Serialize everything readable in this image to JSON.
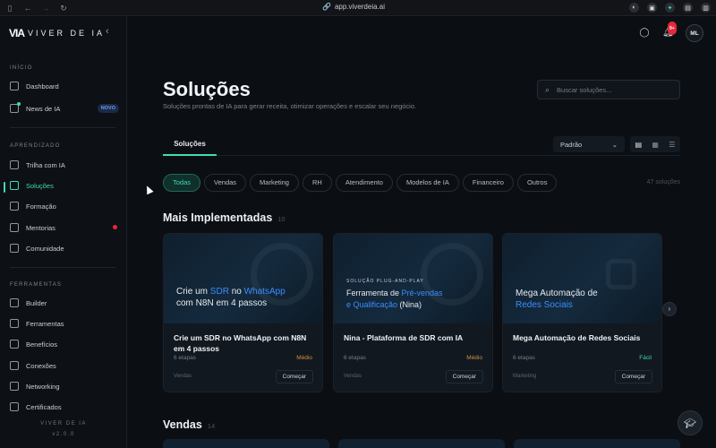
{
  "browser": {
    "url": "app.viverdeia.ai"
  },
  "brand": {
    "name": "VIVER DE IA"
  },
  "sidebar": {
    "sections": [
      {
        "label": "INÍCIO"
      },
      {
        "label": "APRENDIZADO"
      },
      {
        "label": "FERRAMENTAS"
      }
    ],
    "items": [
      {
        "label": "Dashboard",
        "icon": "home-icon"
      },
      {
        "label": "News de IA",
        "icon": "rss-icon",
        "badge": "NOVO"
      },
      {
        "label": "Trilha com IA",
        "icon": "path-icon"
      },
      {
        "label": "Soluções",
        "icon": "book-icon",
        "active": true
      },
      {
        "label": "Formação",
        "icon": "graduation-icon"
      },
      {
        "label": "Mentorias",
        "icon": "calendar-icon"
      },
      {
        "label": "Comunidade",
        "icon": "chat-icon"
      },
      {
        "label": "Builder",
        "icon": "builder-icon"
      },
      {
        "label": "Ferramentas",
        "icon": "tools-icon"
      },
      {
        "label": "Benefícios",
        "icon": "trophy-icon"
      },
      {
        "label": "Conexões",
        "icon": "users-icon"
      },
      {
        "label": "Networking",
        "icon": "network-icon"
      },
      {
        "label": "Certificados",
        "icon": "certificate-icon"
      }
    ],
    "footer_brand": "VIVER DE IA",
    "version": "v2.0.0"
  },
  "topbar": {
    "notifications": "9+",
    "avatar": "ML"
  },
  "page": {
    "title": "Soluções",
    "subtitle": "Soluções prontas de IA para gerar receita, otimizar operações e escalar seu negócio.",
    "search_placeholder": "Buscar soluções..."
  },
  "tabs": [
    {
      "label": "Soluções"
    }
  ],
  "sort": {
    "value": "Padrão"
  },
  "filters": [
    "Todas",
    "Vendas",
    "Marketing",
    "RH",
    "Atendimento",
    "Modelos de IA",
    "Financeiro",
    "Outros"
  ],
  "results_count": "47 soluções",
  "sections": {
    "featured": {
      "title": "Mais Implementadas",
      "count": "10"
    },
    "sales": {
      "title": "Vendas",
      "count": "14"
    }
  },
  "cards": [
    {
      "img_small": "",
      "img_parts": [
        "Crie um ",
        "SDR",
        " no ",
        "WhatsApp",
        "com N8N em 4 passos"
      ],
      "name": "Crie um SDR no WhatsApp com N8N em 4 passos",
      "steps": "6 etapas",
      "level": "Médio",
      "category": "Vendas",
      "button": "Começar"
    },
    {
      "img_small": "SOLUÇÃO PLUG-AND-PLAY",
      "img_parts": [
        "Ferramenta de ",
        "Pré-vendas",
        "e Qualificação",
        " (Nina)"
      ],
      "name": "Nina - Plataforma de SDR com IA",
      "steps": "6 etapas",
      "level": "Médio",
      "category": "Vendas",
      "button": "Começar"
    },
    {
      "img_small": "",
      "img_parts": [
        "Mega Automação de ",
        "Redes Sociais"
      ],
      "name": "Mega Automação de Redes Sociais",
      "steps": "6 etapas",
      "level": "Fácil",
      "category": "Marketing",
      "button": "Começar"
    }
  ],
  "colors": {
    "accent": "#3ddbb4",
    "highlight": "#3a8dff",
    "medium": "#d3913a",
    "badge_red": "#e5283a"
  }
}
